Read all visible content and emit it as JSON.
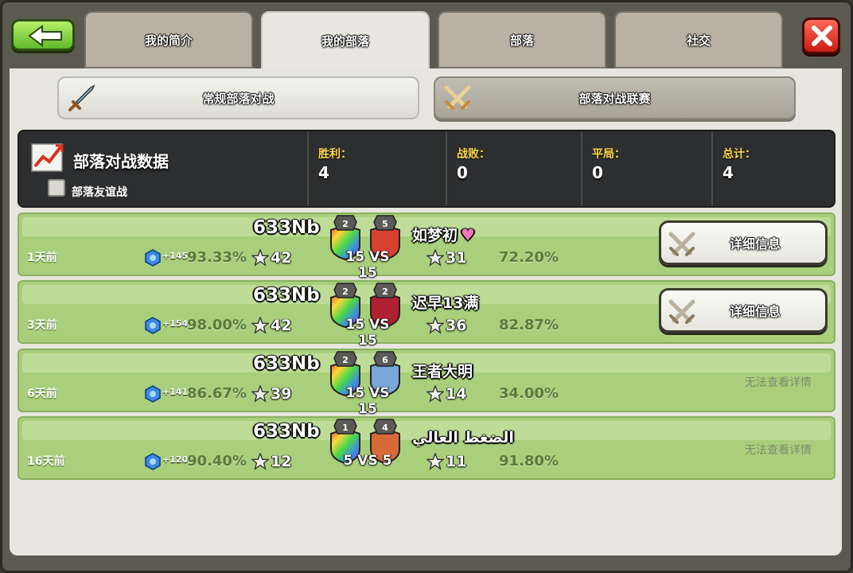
{
  "tabs": [
    {
      "label": "我的简介"
    },
    {
      "label": "我的部落"
    },
    {
      "label": "部落"
    },
    {
      "label": "社交"
    }
  ],
  "war_modes": {
    "regular": "常规部落对战",
    "league": "部落对战联赛"
  },
  "stats": {
    "title": "部落对战数据",
    "friendly_label": "部落友谊战",
    "wins_label": "胜利：",
    "wins": "4",
    "losses_label": "战败：",
    "losses": "0",
    "draws_label": "平局：",
    "draws": "0",
    "total_label": "总计：",
    "total": "4"
  },
  "wars": [
    {
      "ago": "1天前",
      "xp": "+145",
      "our_pct": "93.33%",
      "our_stars": "42",
      "our_name": "633Nb",
      "our_level": "2",
      "their_level": "5",
      "size": "15 VS 15",
      "their_name": "如梦初",
      "their_heart": "♥",
      "their_stars": "31",
      "their_pct": "72.20%",
      "detail": "详细信息",
      "their_color": "#d84030"
    },
    {
      "ago": "3天前",
      "xp": "+154",
      "our_pct": "98.00%",
      "our_stars": "42",
      "our_name": "633Nb",
      "our_level": "2",
      "their_level": "2",
      "size": "15 VS 15",
      "their_name": "迟早13满",
      "their_heart": "",
      "their_stars": "36",
      "their_pct": "82.87%",
      "detail": "详细信息",
      "their_color": "#b02030"
    },
    {
      "ago": "6天前",
      "xp": "+141",
      "our_pct": "86.67%",
      "our_stars": "39",
      "our_name": "633Nb",
      "our_level": "2",
      "their_level": "6",
      "size": "15 VS 15",
      "their_name": "王者大明",
      "their_heart": "",
      "their_stars": "14",
      "their_pct": "34.00%",
      "detail": "无法查看详情",
      "their_color": "#7aa6d8"
    },
    {
      "ago": "16天前",
      "xp": "+120",
      "our_pct": "90.40%",
      "our_stars": "12",
      "our_name": "633Nb",
      "our_level": "1",
      "their_level": "4",
      "size": "5 VS 5",
      "their_name": "الضغط العالي",
      "their_heart": "",
      "their_stars": "11",
      "their_pct": "91.80%",
      "detail": "无法查看详情",
      "their_color": "#d86a3a"
    }
  ],
  "icons": {
    "back": "back-arrow-icon",
    "close": "close-x-icon",
    "sword": "sword-icon",
    "crossed_swords": "crossed-swords-icon",
    "chart": "chart-icon",
    "star": "star-icon",
    "xp": "xp-badge-icon",
    "shield": "clan-badge-icon"
  },
  "colors": {
    "row_green": "#a9cf7c",
    "stat_yellow": "#ffd84a",
    "close_red": "#c81c12",
    "back_green": "#5fb82a"
  }
}
